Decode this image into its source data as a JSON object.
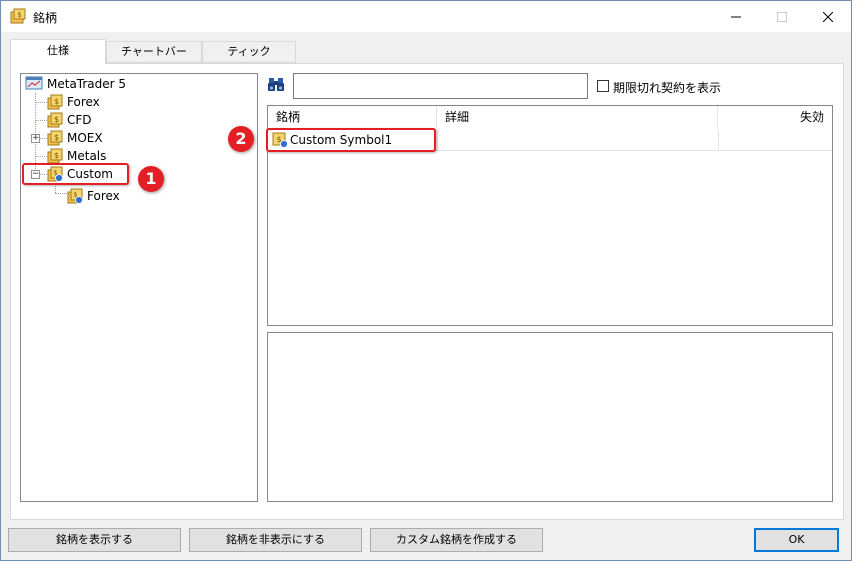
{
  "window": {
    "title": "銘柄",
    "controls": {
      "minimize": "—",
      "maximize": "☐",
      "close": "✕"
    }
  },
  "tabs": [
    {
      "label": "仕様",
      "active": true
    },
    {
      "label": "チャートバー",
      "active": false
    },
    {
      "label": "ティック",
      "active": false
    }
  ],
  "tree": {
    "root": "MetaTrader 5",
    "items": [
      {
        "label": "Forex",
        "icon": "folder-currency-icon"
      },
      {
        "label": "CFD",
        "icon": "folder-currency-icon"
      },
      {
        "label": "MOEX",
        "icon": "folder-currency-icon",
        "expandable": true
      },
      {
        "label": "Metals",
        "icon": "folder-currency-icon"
      },
      {
        "label": "Custom",
        "icon": "folder-custom-icon",
        "expanded": true,
        "selected": true
      },
      {
        "label": "Forex",
        "icon": "folder-custom-icon",
        "child": true
      }
    ]
  },
  "search": {
    "value": "",
    "placeholder": "",
    "checkbox_label": "期限切れ契約を表示",
    "checkbox_checked": false
  },
  "symbol_list": {
    "columns": [
      "銘柄",
      "詳細",
      "失効"
    ],
    "rows": [
      {
        "symbol": "Custom Symbol1",
        "detail": "",
        "expiry": ""
      }
    ]
  },
  "buttons": {
    "show_symbol": "銘柄を表示する",
    "hide_symbol": "銘柄を非表示にする",
    "create_custom": "カスタム銘柄を作成する",
    "ok": "OK"
  },
  "annotations": [
    {
      "number": "1",
      "target": "Custom"
    },
    {
      "number": "2",
      "target": "Custom Symbol1"
    }
  ],
  "colors": {
    "annotation": "#e31e24",
    "accent": "#0078d7",
    "folder_yellow": "#f2c14e"
  }
}
